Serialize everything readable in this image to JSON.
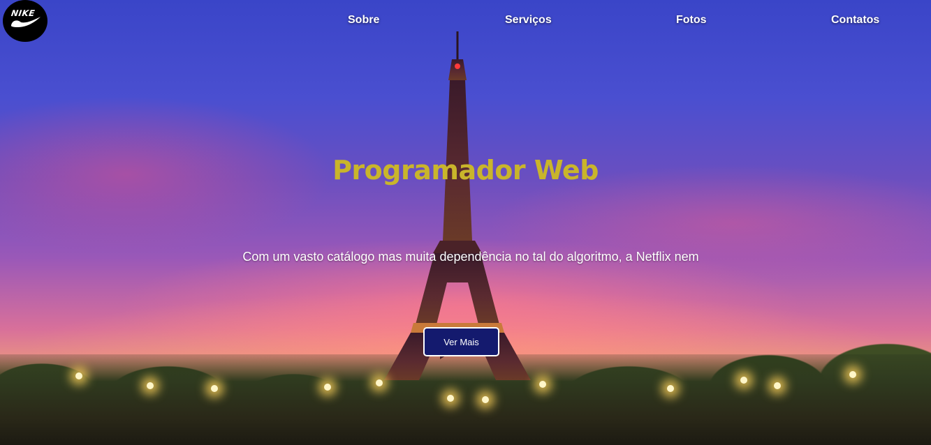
{
  "brand": {
    "logo_text": "NIKE",
    "logo_icon": "swoosh-icon",
    "logo_bg": "#000000"
  },
  "nav": {
    "items": [
      {
        "label": "Sobre"
      },
      {
        "label": "Serviços"
      },
      {
        "label": "Fotos"
      },
      {
        "label": "Contatos"
      }
    ]
  },
  "hero": {
    "title": "Programador Web",
    "title_color": "#c9b52b",
    "subtitle": "Com um vasto catálogo mas muita dependência no tal do algoritmo, a Netflix nem",
    "cta_label": "Ver Mais",
    "cta_color": "#141a6e",
    "background": "eiffel-tower-sunset-photo"
  }
}
